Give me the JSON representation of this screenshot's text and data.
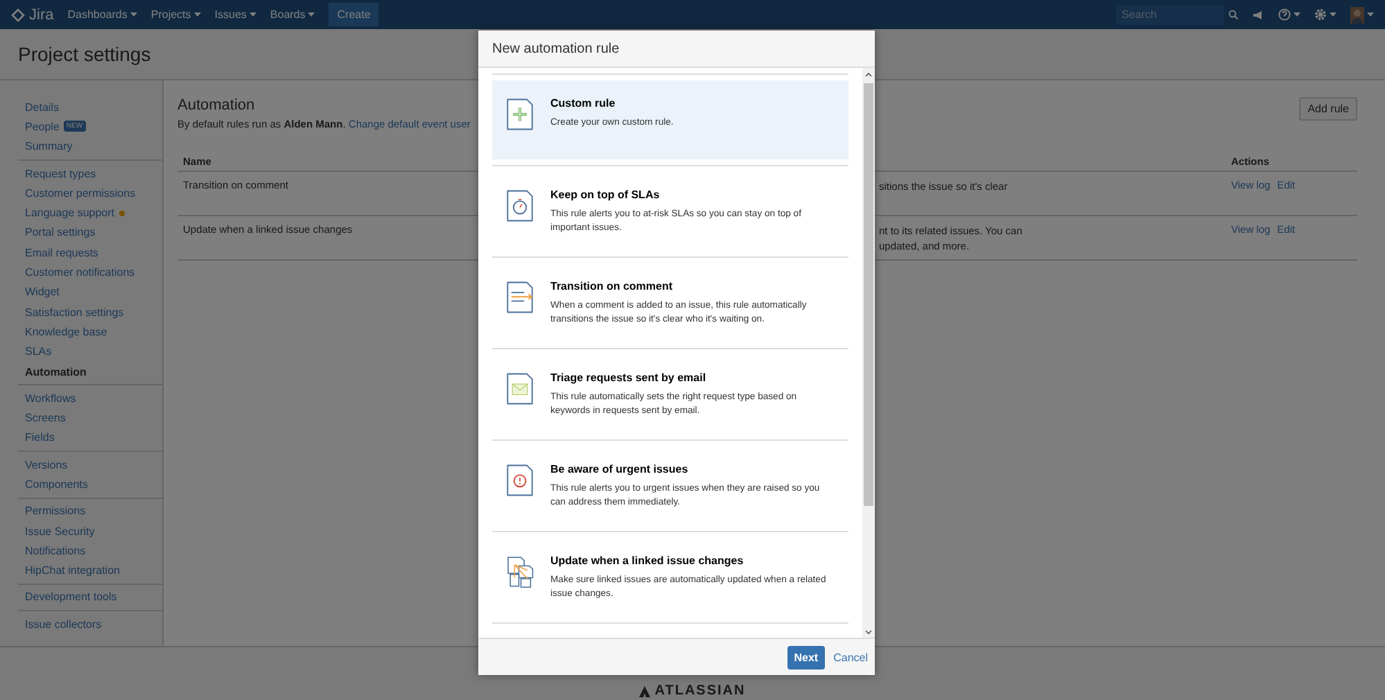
{
  "nav": {
    "logo": "Jira",
    "menus": [
      {
        "label": "Dashboards"
      },
      {
        "label": "Projects"
      },
      {
        "label": "Issues"
      },
      {
        "label": "Boards"
      }
    ],
    "create": "Create",
    "search": {
      "placeholder": "Search"
    }
  },
  "page_title": "Project settings",
  "sidebar": {
    "groups": [
      {
        "items": [
          {
            "label": "Details",
            "selected": false,
            "notice": false
          },
          {
            "label": "People",
            "selected": false,
            "badge": "NEW",
            "notice": false
          },
          {
            "label": "Summary",
            "selected": false,
            "notice": false
          }
        ]
      },
      {
        "items": [
          {
            "label": "Request types",
            "selected": false,
            "notice": false
          },
          {
            "label": "Customer permissions",
            "selected": false,
            "notice": false
          },
          {
            "label": "Language support",
            "selected": false,
            "notice": true
          },
          {
            "label": "Portal settings",
            "selected": false,
            "notice": false
          },
          {
            "label": "Email requests",
            "selected": false,
            "notice": false
          },
          {
            "label": "Customer notifications",
            "selected": false,
            "notice": false
          },
          {
            "label": "Widget",
            "selected": false,
            "notice": false
          },
          {
            "label": "Satisfaction settings",
            "selected": false,
            "notice": false
          },
          {
            "label": "Knowledge base",
            "selected": false,
            "notice": false
          },
          {
            "label": "SLAs",
            "selected": false,
            "notice": false
          },
          {
            "label": "Automation",
            "selected": true,
            "notice": false
          }
        ]
      },
      {
        "items": [
          {
            "label": "Workflows",
            "selected": false,
            "notice": false
          },
          {
            "label": "Screens",
            "selected": false,
            "notice": false
          },
          {
            "label": "Fields",
            "selected": false,
            "notice": false
          }
        ]
      },
      {
        "items": [
          {
            "label": "Versions",
            "selected": false,
            "notice": false
          },
          {
            "label": "Components",
            "selected": false,
            "notice": false
          }
        ]
      },
      {
        "items": [
          {
            "label": "Permissions",
            "selected": false,
            "notice": false
          },
          {
            "label": "Issue Security",
            "selected": false,
            "notice": false
          },
          {
            "label": "Notifications",
            "selected": false,
            "notice": false
          },
          {
            "label": "HipChat integration",
            "selected": false,
            "notice": false
          }
        ]
      },
      {
        "items": [
          {
            "label": "Development tools",
            "selected": false,
            "notice": false
          }
        ]
      },
      {
        "items": [
          {
            "label": "Issue collectors",
            "selected": false,
            "notice": false
          }
        ]
      }
    ]
  },
  "content": {
    "heading": "Automation",
    "default_user": "By default rules run as **Alden Mann**.",
    "change_link": "Change default event user",
    "add_rule": "Add rule",
    "columns": [
      "Name",
      "Actions"
    ],
    "rows": [
      {
        "name": "Transition on comment",
        "description": [
          "sitions the issue so it's clear"
        ],
        "actions": [
          "View log",
          "Edit"
        ]
      },
      {
        "name": "Update when a linked issue changes",
        "description": [
          "nt to its related issues. You can",
          "updated, and more."
        ],
        "actions": [
          "View log",
          "Edit"
        ]
      }
    ]
  },
  "modal": {
    "title": "New automation rule",
    "items": [
      {
        "kind": "custom",
        "title": "Custom rule",
        "description": "Create your own custom rule.",
        "selected": true
      },
      {
        "kind": "sla",
        "title": "Keep on top of SLAs",
        "description": "This rule alerts you to at-risk SLAs so you can stay on top of important issues.",
        "selected": false
      },
      {
        "kind": "comment",
        "title": "Transition on comment",
        "description": "When a comment is added to an issue, this rule automatically transitions the issue so it's clear who it's waiting on.",
        "selected": false
      },
      {
        "kind": "email",
        "title": "Triage requests sent by email",
        "description": "This rule automatically sets the right request type based on keywords in requests sent by email.",
        "selected": false
      },
      {
        "kind": "urgent",
        "title": "Be aware of urgent issues",
        "description": "This rule alerts you to urgent issues when they are raised so you can address them immediately.",
        "selected": false
      },
      {
        "kind": "linked",
        "title": "Update when a linked issue changes",
        "description": "Make sure linked issues are automatically updated when a related issue changes.",
        "selected": false
      }
    ],
    "next": "Next",
    "cancel": "Cancel"
  },
  "footer": {
    "logo": "ATLASSIAN"
  }
}
